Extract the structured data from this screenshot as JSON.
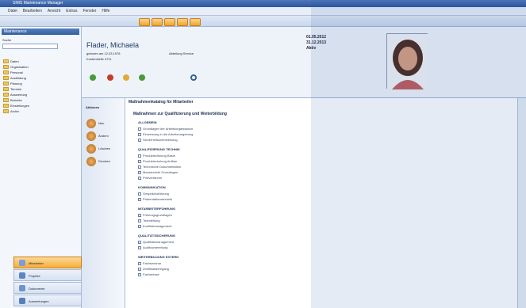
{
  "window": {
    "title": "SIMS Maintenance Manager"
  },
  "menu": [
    "Datei",
    "Bearbeiten",
    "Ansicht",
    "Extras",
    "Fenster",
    "Hilfe"
  ],
  "sidebar": {
    "header": "Maintenance",
    "search_label": "Suche",
    "tree": [
      "Daten",
      "Organisation",
      "Personal",
      "Ausbildung",
      "Planung",
      "Termine",
      "Auswertung",
      "Berichte",
      "Einstellungen",
      "Archiv"
    ],
    "nav": [
      {
        "label": "Mitarbeiter",
        "active": true
      },
      {
        "label": "Projekte",
        "active": false
      },
      {
        "label": "Dokumente",
        "active": false
      },
      {
        "label": "Auswertungen",
        "active": false
      }
    ]
  },
  "quick": {
    "title": "Aktionen",
    "items": [
      "Neu",
      "Ändern",
      "Löschen",
      "Drucken"
    ]
  },
  "header": {
    "name": "Flader, Michaela",
    "line1": "geboren am 12.03.1978",
    "line2": "Kostenstelle 4711",
    "line3": "Abteilung Service",
    "dates": [
      "01.05.2012",
      "31.12.2013"
    ],
    "status": "Aktiv"
  },
  "content": {
    "title": "Maßnahmenkatalog für Mitarbeiter",
    "heading": "Maßnahmen zur Qualifizierung und Weiterbildung",
    "sections": [
      {
        "title": "ALLGEMEIN",
        "lines": [
          "Grundlagen der Arbeitsorganisation",
          "Einweisung in die Arbeitsumgebung",
          "Sicherheitsunterweisung"
        ]
      },
      {
        "title": "QUALIFIZIERUNG TECHNIK",
        "lines": [
          "Produktschulung Basis",
          "Produktschulung Aufbau",
          "Technische Dokumentation",
          "Messtechnik Grundlagen",
          "Prüfverfahren"
        ]
      },
      {
        "title": "KOMMUNIKATION",
        "lines": [
          "Gesprächsführung",
          "Präsentationstechnik"
        ]
      },
      {
        "title": "MITARBEITERFÜHRUNG",
        "lines": [
          "Führungsgrundlagen",
          "Teamleitung",
          "Konfliktmanagement"
        ]
      },
      {
        "title": "QUALITÄTSSICHERUNG",
        "lines": [
          "Qualitätsmanagement",
          "Auditvorbereitung"
        ]
      },
      {
        "title": "WEITERBILDUNG EXTERN",
        "lines": [
          "Fachseminar",
          "Zertifikatslehrgang",
          "Fachmesse"
        ]
      }
    ]
  }
}
